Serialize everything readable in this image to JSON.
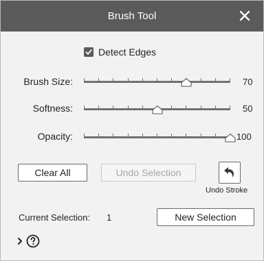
{
  "window": {
    "title": "Brush Tool"
  },
  "icons": {
    "close": "close-icon",
    "checkmark": "checkmark-icon",
    "undo": "undo-arrow-icon",
    "chevron": "chevron-right-icon",
    "help": "help-icon"
  },
  "options": {
    "detect_edges": {
      "label": "Detect Edges",
      "checked": true
    }
  },
  "sliders": [
    {
      "id": "brush-size",
      "label": "Brush Size:",
      "value": "70",
      "fraction": 0.7
    },
    {
      "id": "softness",
      "label": "Softness:",
      "value": "50",
      "fraction": 0.5
    },
    {
      "id": "opacity",
      "label": "Opacity:",
      "value": "100",
      "fraction": 1.0
    }
  ],
  "buttons": {
    "clear_all": "Clear All",
    "undo_selection": "Undo Selection",
    "undo_stroke": "Undo Stroke",
    "new_selection": "New Selection"
  },
  "selection": {
    "label": "Current Selection:",
    "value": "1"
  },
  "colors": {
    "titlebar": "#5b5b5b",
    "panel": "#f2f2f2",
    "track": "#707070"
  }
}
